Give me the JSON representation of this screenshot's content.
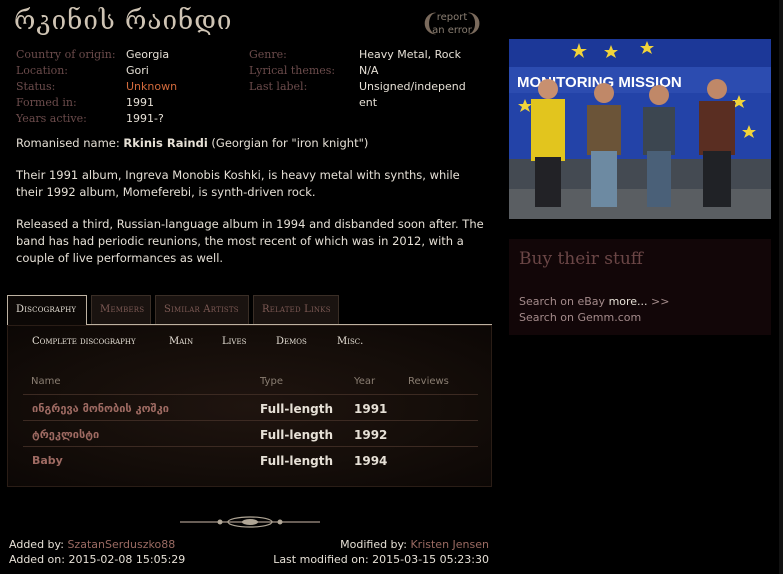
{
  "band": {
    "name": "რკინის რაინდი"
  },
  "report": {
    "line1": "report",
    "line2": "an error"
  },
  "facts_left": [
    {
      "key": "Country of origin:",
      "value": "Georgia"
    },
    {
      "key": "Location:",
      "value": "Gori"
    },
    {
      "key": "Status:",
      "value": "Unknown"
    },
    {
      "key": "Formed in:",
      "value": "1991"
    },
    {
      "key": "Years active:",
      "value": "1991-?"
    }
  ],
  "facts_right": [
    {
      "key": "Genre:",
      "value": "Heavy Metal, Rock"
    },
    {
      "key": "Lyrical themes:",
      "value": "N/A"
    },
    {
      "key": "Last label:",
      "value": "Unsigned/independ"
    },
    {
      "key": "",
      "value": "ent"
    }
  ],
  "bio": {
    "romanised_label": "Romanised name:",
    "romanised_name": "Rkinis Raindi",
    "romanised_note": "(Georgian for \"iron knight\")",
    "p2": "Their 1991 album, Ingreva Monobis Koshki, is heavy metal with synths, while their 1992 album, Momeferebi, is synth-driven rock.",
    "p3": "Released a third, Russian-language album in 1994 and disbanded soon after. The band has had periodic reunions, the most recent of which was in 2012, with a couple of live performances as well."
  },
  "tabs": [
    "Discography",
    "Members",
    "Similar Artists",
    "Related Links"
  ],
  "subnav": [
    "Complete discography",
    "Main",
    "Lives",
    "Demos",
    "Misc."
  ],
  "table": {
    "headers": [
      "Name",
      "Type",
      "Year",
      "Reviews"
    ],
    "rows": [
      {
        "name": "ინგრევა მონობის კოშკი",
        "type": "Full-length",
        "year": "1991"
      },
      {
        "name": "ტრეკლისტი",
        "type": "Full-length",
        "year": "1992"
      },
      {
        "name": "Baby",
        "type": "Full-length",
        "year": "1994"
      }
    ]
  },
  "footer": {
    "added_by_label": "Added by:",
    "added_by": "SzatanSerduszko88",
    "added_on_label": "Added on:",
    "added_on": "2015-02-08 15:05:29",
    "modified_by_label": "Modified by:",
    "modified_by": "Kristen Jensen",
    "last_modified_label": "Last modified on:",
    "last_modified": "2015-03-15 05:23:30"
  },
  "photo": {
    "banner_text": "MONITORING MISSION"
  },
  "buy": {
    "title": "Buy their stuff",
    "ebay": "Search on eBay",
    "more": "more...",
    "arrows": ">>",
    "gemm": "Search on Gemm.com"
  },
  "colors": {
    "label": "#6b4b4b",
    "status_unknown": "#d26a3c",
    "link": "#9a6a62",
    "buy_bg": "#120608"
  }
}
